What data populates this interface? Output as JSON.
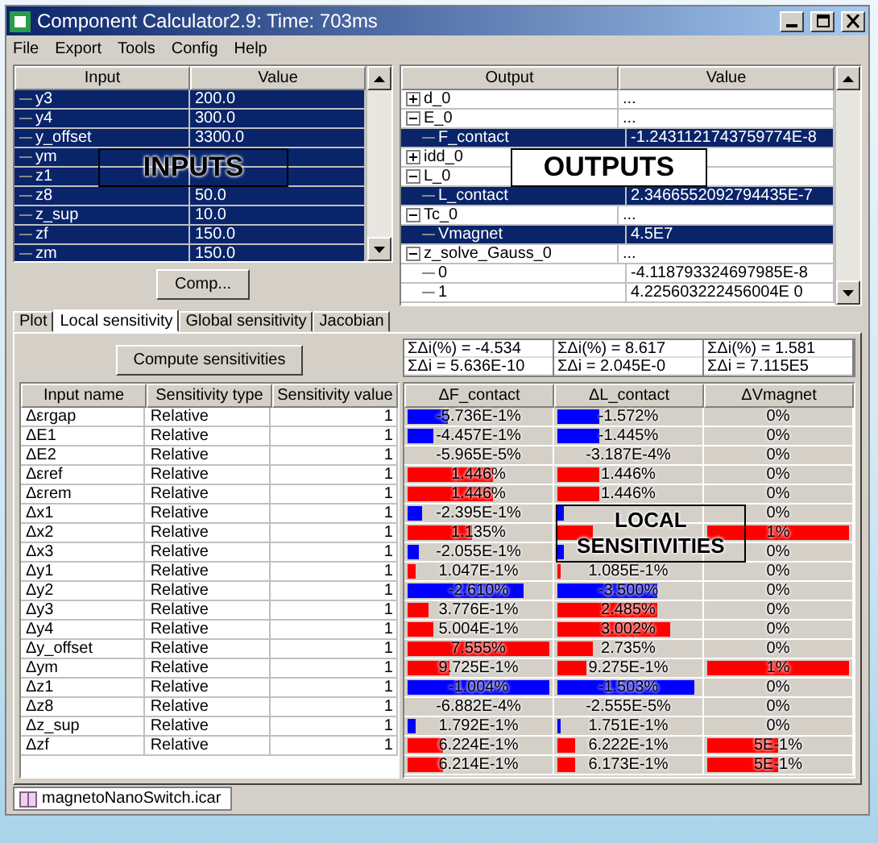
{
  "window": {
    "title": "Component Calculator2.9: Time: 703ms"
  },
  "menu": [
    "File",
    "Export",
    "Tools",
    "Config",
    "Help"
  ],
  "inputs": {
    "columns": [
      "Input",
      "Value"
    ],
    "rows": [
      {
        "name": "y3",
        "value": "200.0",
        "selected": true
      },
      {
        "name": "y4",
        "value": "300.0",
        "selected": true
      },
      {
        "name": "y_offset",
        "value": "3300.0",
        "selected": true
      },
      {
        "name": "ym",
        "selected": true
      },
      {
        "name": "z1",
        "selected": true
      },
      {
        "name": "z8",
        "value": "50.0",
        "selected": true
      },
      {
        "name": "z_sup",
        "value": "10.0",
        "selected": true
      },
      {
        "name": "zf",
        "value": "150.0",
        "selected": true
      },
      {
        "name": "zm",
        "value": "150.0",
        "selected": true
      }
    ],
    "button": "Comp...",
    "annotation": "INPUTS"
  },
  "outputs": {
    "columns": [
      "Output",
      "Value"
    ],
    "rows": [
      {
        "name": "d_0",
        "value": "...",
        "expanded": false,
        "selected": false
      },
      {
        "name": "E_0",
        "value": "...",
        "expanded": true,
        "selected": false,
        "children": [
          {
            "name": "F_contact",
            "value": "-1.2431121743759774E-8",
            "selected": true
          }
        ]
      },
      {
        "name": "idd_0",
        "expanded": false,
        "selected": false
      },
      {
        "name": "L_0",
        "expanded": true,
        "selected": false,
        "children": [
          {
            "name": "L_contact",
            "value": "2.3466552092794435E-7",
            "selected": true
          }
        ]
      },
      {
        "name": "Tc_0",
        "value": "...",
        "expanded": true,
        "selected": false,
        "children": [
          {
            "name": "Vmagnet",
            "value": "4.5E7",
            "selected": true
          }
        ]
      },
      {
        "name": "z_solve_Gauss_0",
        "value": "...",
        "expanded": true,
        "selected": false,
        "children": [
          {
            "name": "0",
            "value": "-4.118793324697985E-8",
            "selected": false
          },
          {
            "name": "1",
            "value": "4.225603222456004E 0",
            "selected": false
          }
        ]
      }
    ],
    "annotation": "OUTPUTS"
  },
  "tabs": [
    {
      "label": "Plot",
      "selected": false
    },
    {
      "label": "Local sensitivity",
      "selected": true
    },
    {
      "label": "Global sensitivity",
      "selected": false
    },
    {
      "label": "Jacobian",
      "selected": false
    }
  ],
  "sensitivities": {
    "button": "Compute sensitivities",
    "input_columns": [
      "Input name",
      "Sensitivity type",
      "Sensitivity value"
    ],
    "inputs": [
      {
        "name": "Δεrgap",
        "type": "Relative",
        "value": "1"
      },
      {
        "name": "ΔE1",
        "type": "Relative",
        "value": "1"
      },
      {
        "name": "ΔE2",
        "type": "Relative",
        "value": "1"
      },
      {
        "name": "Δεref",
        "type": "Relative",
        "value": "1"
      },
      {
        "name": "Δεrem",
        "type": "Relative",
        "value": "1"
      },
      {
        "name": "Δx1",
        "type": "Relative",
        "value": "1"
      },
      {
        "name": "Δx2",
        "type": "Relative",
        "value": "1"
      },
      {
        "name": "Δx3",
        "type": "Relative",
        "value": "1"
      },
      {
        "name": "Δy1",
        "type": "Relative",
        "value": "1"
      },
      {
        "name": "Δy2",
        "type": "Relative",
        "value": "1"
      },
      {
        "name": "Δy3",
        "type": "Relative",
        "value": "1"
      },
      {
        "name": "Δy4",
        "type": "Relative",
        "value": "1"
      },
      {
        "name": "Δy_offset",
        "type": "Relative",
        "value": "1"
      },
      {
        "name": "Δym",
        "type": "Relative",
        "value": "1"
      },
      {
        "name": "Δz1",
        "type": "Relative",
        "value": "1"
      },
      {
        "name": "Δz8",
        "type": "Relative",
        "value": "1"
      },
      {
        "name": "Δz_sup",
        "type": "Relative",
        "value": "1"
      },
      {
        "name": "Δzf",
        "type": "Relative",
        "value": "1"
      }
    ],
    "sums": [
      {
        "percent": "ΣΔi(%) = -4.534",
        "total": "ΣΔi = 5.636E-10"
      },
      {
        "percent": "ΣΔi(%) = 8.617",
        "total": "ΣΔi = 2.045E-0"
      },
      {
        "percent": "ΣΔi(%) = 1.581",
        "total": "ΣΔi = 7.115E5"
      }
    ],
    "output_columns": [
      "ΔF_contact",
      "ΔL_contact",
      "ΔVmagnet"
    ],
    "rows": [
      {
        "cells": [
          {
            "text": "-5.736E-1%",
            "level": 0.28,
            "color": "#0000ff"
          },
          {
            "text": "-1.572%",
            "level": 0.3,
            "color": "#0000ff"
          },
          {
            "text": "0%"
          }
        ]
      },
      {
        "cells": [
          {
            "text": "-4.457E-1%",
            "level": 0.18,
            "color": "#0000ff"
          },
          {
            "text": "-1.445%",
            "level": 0.3,
            "color": "#0000ff"
          },
          {
            "text": "0%"
          }
        ]
      },
      {
        "cells": [
          {
            "text": "-5.965E-5%"
          },
          {
            "text": "-3.187E-4%"
          },
          {
            "text": "0%"
          }
        ]
      },
      {
        "cells": [
          {
            "text": "1.446%",
            "level": 0.6,
            "color": "#ff0000"
          },
          {
            "text": "1.446%",
            "level": 0.3,
            "color": "#ff0000"
          },
          {
            "text": "0%"
          }
        ]
      },
      {
        "cells": [
          {
            "text": "1.446%",
            "level": 0.6,
            "color": "#ff0000"
          },
          {
            "text": "1.446%",
            "level": 0.3,
            "color": "#ff0000"
          },
          {
            "text": "0%"
          }
        ]
      },
      {
        "cells": [
          {
            "text": "-2.395E-1%",
            "level": 0.1,
            "color": "#0000ff"
          },
          {
            "level": 0.04,
            "color": "#0000ff"
          },
          {
            "text": "0%"
          }
        ]
      },
      {
        "cells": [
          {
            "text": "1.135%",
            "level": 0.45,
            "color": "#ff0000"
          },
          {
            "level": 0.25,
            "color": "#ff0000"
          },
          {
            "text": "1%",
            "level": 1,
            "color": "#ff0000"
          }
        ]
      },
      {
        "cells": [
          {
            "text": "-2.055E-1%",
            "level": 0.08,
            "color": "#0000ff"
          },
          {
            "level": 0.05,
            "color": "#0000ff"
          },
          {
            "text": "0%"
          }
        ]
      },
      {
        "cells": [
          {
            "text": "1.047E-1%",
            "level": 0.06,
            "color": "#ff0000"
          },
          {
            "text": "1.085E-1%",
            "level": 0.02,
            "color": "#ff0000"
          },
          {
            "text": "0%"
          }
        ]
      },
      {
        "cells": [
          {
            "text": "-2.610%",
            "level": 0.82,
            "color": "#0000ff"
          },
          {
            "text": "-3.500%",
            "level": 0.7,
            "color": "#0000ff"
          },
          {
            "text": "0%"
          }
        ]
      },
      {
        "cells": [
          {
            "text": "3.776E-1%",
            "level": 0.15,
            "color": "#ff0000"
          },
          {
            "text": "2.485%",
            "level": 0.7,
            "color": "#ff0000"
          },
          {
            "text": "0%"
          }
        ]
      },
      {
        "cells": [
          {
            "text": "5.004E-1%",
            "level": 0.18,
            "color": "#ff0000"
          },
          {
            "text": "3.002%",
            "level": 0.8,
            "color": "#ff0000"
          },
          {
            "text": "0%"
          }
        ]
      },
      {
        "cells": [
          {
            "text": "7.555%",
            "level": 1,
            "color": "#ff0000"
          },
          {
            "text": "2.735%",
            "level": 0.25,
            "color": "#ff0000"
          },
          {
            "text": "0%"
          }
        ]
      },
      {
        "cells": [
          {
            "text": "9.725E-1%",
            "level": 0.3,
            "color": "#ff0000"
          },
          {
            "text": "9.275E-1%",
            "level": 0.2,
            "color": "#ff0000"
          },
          {
            "text": "1%",
            "level": 1,
            "color": "#ff0000"
          }
        ]
      },
      {
        "cells": [
          {
            "text": "-1.004%",
            "level": 1,
            "color": "#0000ff"
          },
          {
            "text": "-1.503%",
            "level": 0.97,
            "color": "#0000ff"
          },
          {
            "text": "0%"
          }
        ]
      },
      {
        "cells": [
          {
            "text": "-6.882E-4%"
          },
          {
            "text": "-2.555E-5%"
          },
          {
            "text": "0%"
          }
        ]
      },
      {
        "cells": [
          {
            "text": "1.792E-1%",
            "level": 0.06,
            "color": "#0000ff"
          },
          {
            "text": "1.751E-1%",
            "level": 0.02,
            "color": "#0000ff"
          },
          {
            "text": "0%"
          }
        ]
      },
      {
        "cells": [
          {
            "text": "6.224E-1%",
            "level": 0.25,
            "color": "#ff0000"
          },
          {
            "text": "6.222E-1%",
            "level": 0.12,
            "color": "#ff0000"
          },
          {
            "text": "5E-1%",
            "level": 0.5,
            "color": "#ff0000"
          }
        ]
      },
      {
        "cells": [
          {
            "text": "6.214E-1%",
            "level": 0.25,
            "color": "#ff0000"
          },
          {
            "text": "6.173E-1%",
            "level": 0.12,
            "color": "#ff0000"
          },
          {
            "text": "5E-1%",
            "level": 0.5,
            "color": "#ff0000"
          }
        ]
      }
    ],
    "annotation": "LOCAL SENSITIVITIES"
  },
  "document_tab": {
    "label": "magnetoNanoSwitch.icar"
  }
}
